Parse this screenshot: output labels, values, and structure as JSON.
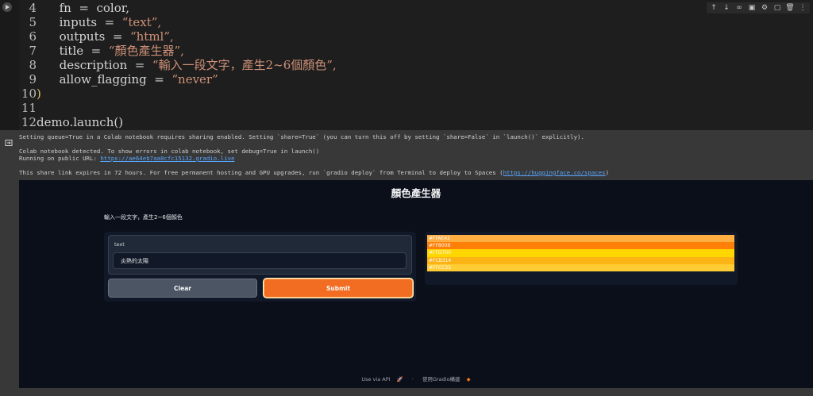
{
  "code": {
    "lines": [
      {
        "num": "4",
        "code": "      fn  =  color,"
      },
      {
        "num": "5",
        "code": "      inputs  =  ",
        "str": "“text”,"
      },
      {
        "num": "6",
        "code": "      outputs  =  ",
        "str": "“html”,"
      },
      {
        "num": "7",
        "code": "      title  =  ",
        "str": "“顏色產生器”,"
      },
      {
        "num": "8",
        "code": "      description  =  ",
        "str": "“輸入一段文字，產生2~6個顏色”,"
      },
      {
        "num": "9",
        "code": "      allow_flagging  =  ",
        "str": "“never”"
      },
      {
        "num": "10",
        "code": ")"
      },
      {
        "num": "11",
        "code": ""
      },
      {
        "num": "12",
        "code": "demo.launch()"
      }
    ]
  },
  "output": {
    "log": [
      "Setting queue=True in a Colab notebook requires sharing enabled. Setting `share=True` (you can turn this off by setting `share=False` in `launch()` explicitly).",
      "",
      "Colab notebook detected. To show errors in colab notebook, set debug=True in launch()",
      "Running on public URL: ",
      "",
      "This share link expires in 72 hours. For free permanent hosting and GPU upgrades, run `gradio deploy` from Terminal to deploy to Spaces ("
    ],
    "public_url": "https://ae64eb7aa8cfc15132.gradio.live",
    "spaces_url": "https://huggingface.co/spaces",
    "log_end": ")"
  },
  "app": {
    "title": "顏色產生器",
    "description": "輸入一段文字，產生2~6個顏色",
    "input_label": "text",
    "input_value": "炎熱的太陽",
    "clear_label": "Clear",
    "submit_label": "Submit",
    "colors": [
      {
        "hex": "#FFAE42"
      },
      {
        "hex": "#FF8008"
      },
      {
        "hex": "#FFD700"
      },
      {
        "hex": "#FCB314"
      },
      {
        "hex": "#FFCC33"
      }
    ],
    "footer_api": "Use via API",
    "footer_sep": "·",
    "footer_built": "使用Gradio構建"
  },
  "colors": {
    "accent": "#F26D21",
    "app_bg": "#0B0F19"
  }
}
